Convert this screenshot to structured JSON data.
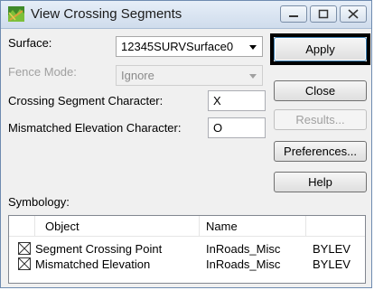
{
  "window": {
    "title": "View Crossing Segments",
    "controls": {
      "minimize_icon": "minimize-icon",
      "maximize_icon": "maximize-icon",
      "close_icon": "close-icon"
    }
  },
  "form": {
    "surface_label": "Surface:",
    "surface_value": "12345SURVSurface0",
    "fence_mode_label": "Fence Mode:",
    "fence_mode_value": "Ignore",
    "crossing_char_label": "Crossing Segment Character:",
    "crossing_char_value": "X",
    "mismatch_char_label": "Mismatched Elevation Character:",
    "mismatch_char_value": "O",
    "symbology_label": "Symbology:"
  },
  "buttons": {
    "apply": "Apply",
    "close": "Close",
    "results": "Results...",
    "preferences": "Preferences...",
    "help": "Help"
  },
  "table": {
    "columns": [
      "Object",
      "Name",
      ""
    ],
    "rows": [
      {
        "checked": true,
        "object": "Segment Crossing Point",
        "name": "InRoads_Misc",
        "level": "BYLEV"
      },
      {
        "checked": true,
        "object": "Mismatched Elevation",
        "name": "InRoads_Misc",
        "level": "BYLEV"
      }
    ]
  }
}
